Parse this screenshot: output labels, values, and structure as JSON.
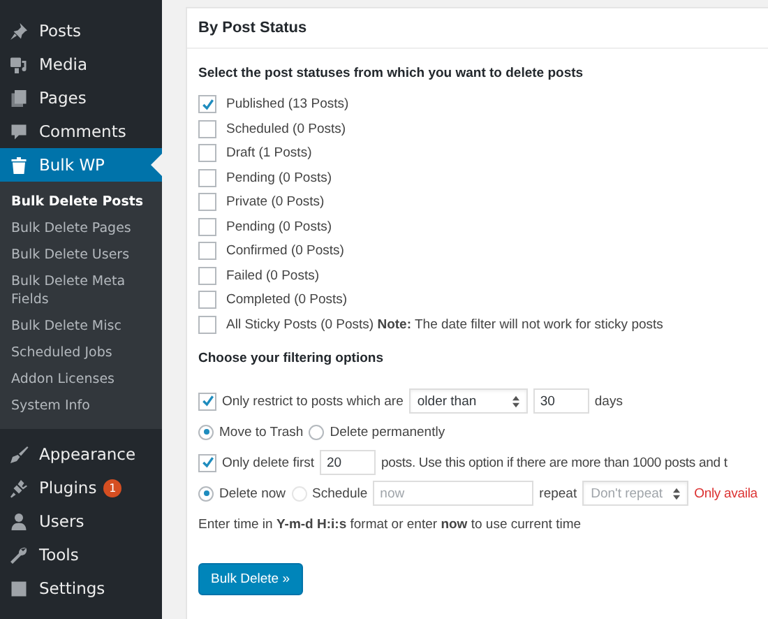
{
  "sidebar": {
    "items": [
      {
        "label": "Posts",
        "selected": false
      },
      {
        "label": "Media",
        "selected": false
      },
      {
        "label": "Pages",
        "selected": false
      },
      {
        "label": "Comments",
        "selected": false
      },
      {
        "label": "Bulk WP",
        "selected": true,
        "children": [
          {
            "label": "Bulk Delete Posts",
            "selected": true
          },
          {
            "label": "Bulk Delete Pages",
            "selected": false
          },
          {
            "label": "Bulk Delete Users",
            "selected": false
          },
          {
            "label": "Bulk Delete Meta Fields",
            "selected": false
          },
          {
            "label": "Bulk Delete Misc",
            "selected": false
          },
          {
            "label": "Scheduled Jobs",
            "selected": false
          },
          {
            "label": "Addon Licenses",
            "selected": false
          },
          {
            "label": "System Info",
            "selected": false
          }
        ]
      },
      {
        "label": "Appearance",
        "selected": false
      },
      {
        "label": "Plugins",
        "selected": false,
        "badge": "1"
      },
      {
        "label": "Users",
        "selected": false
      },
      {
        "label": "Tools",
        "selected": false
      },
      {
        "label": "Settings",
        "selected": false
      }
    ]
  },
  "panel": {
    "title": "By Post Status",
    "statuses_heading": "Select the post statuses from which you want to delete posts",
    "statuses": [
      {
        "label": "Published (13 Posts)",
        "checked": true
      },
      {
        "label": "Scheduled (0 Posts)",
        "checked": false
      },
      {
        "label": "Draft (1 Posts)",
        "checked": false
      },
      {
        "label": "Pending (0 Posts)",
        "checked": false
      },
      {
        "label": "Private (0 Posts)",
        "checked": false
      },
      {
        "label": "Pending (0 Posts)",
        "checked": false
      },
      {
        "label": "Confirmed (0 Posts)",
        "checked": false
      },
      {
        "label": "Failed (0 Posts)",
        "checked": false
      },
      {
        "label": "Completed (0 Posts)",
        "checked": false
      },
      {
        "label": "All Sticky Posts (0 Posts) **Note:** The date filter will not work for sticky posts",
        "checked": false
      }
    ],
    "filter_heading": "Choose your filtering options",
    "restrict": {
      "checked": true,
      "label": "Only restrict to posts which are",
      "select": "older than",
      "days_value": "30",
      "suffix": "days"
    },
    "delete_mode": [
      {
        "label": "Move to Trash",
        "selected": true
      },
      {
        "label": "Delete permanently",
        "selected": false
      }
    ],
    "limit": {
      "checked": true,
      "label": "Only delete first",
      "value": "20",
      "suffix": "posts. Use this option if there are more than 1000 posts and t"
    },
    "schedule": {
      "options": [
        {
          "label": "Delete now",
          "selected": true,
          "disabled": false
        },
        {
          "label": "Schedule",
          "selected": false,
          "disabled": true
        }
      ],
      "placeholder": "now",
      "repeat_label": "repeat",
      "repeat_select": "Don't repeat",
      "note": "Only availa"
    },
    "help": "Enter time in **Y-m-d H:i:s** format or enter **now** to use current time",
    "button": "Bulk Delete »"
  }
}
